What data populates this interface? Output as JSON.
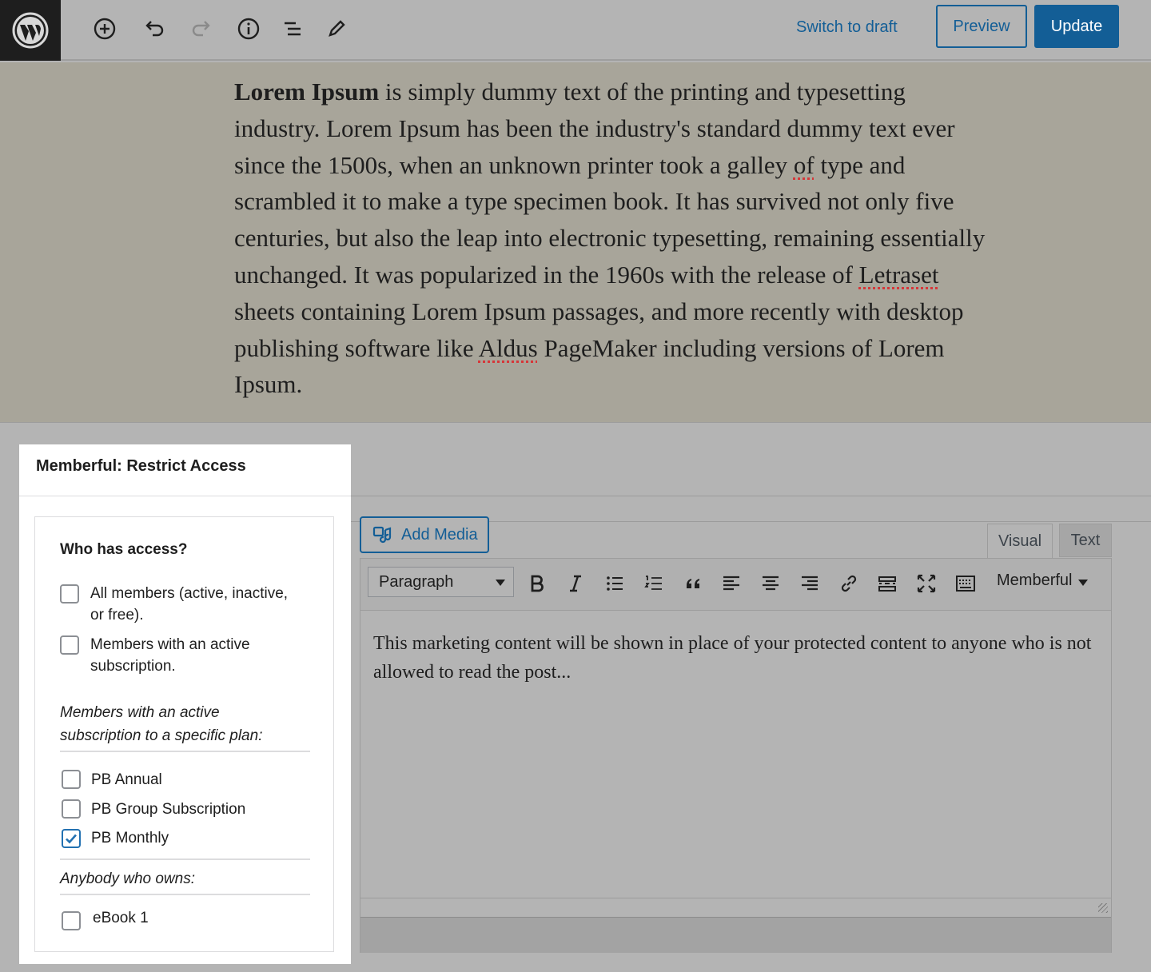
{
  "toolbar": {
    "switch_to_draft": "Switch to draft",
    "preview": "Preview",
    "update": "Update",
    "icons": [
      "wordpress-logo",
      "add-block-icon",
      "undo-icon",
      "redo-icon",
      "info-icon",
      "list-view-icon",
      "edit-icon"
    ]
  },
  "content": {
    "bold_lead": "Lorem Ipsum",
    "seg1": " is simply dummy text of the printing and typesetting industry. Lorem Ipsum has been the industry's standard dummy text ever since the 1500s, when an unknown printer took a galley ",
    "word_of": "of",
    "seg2": " type and scrambled it to make a type specimen book. It has survived not only five centuries, but also the leap into electronic typesetting, remaining essentially unchanged. It was popularized in the 1960s with the release of ",
    "word_letraset": "Letraset",
    "seg3": " sheets containing Lorem Ipsum passages, and more recently with desktop publishing software like ",
    "word_aldus": "Aldus",
    "seg4": " PageMaker including versions of Lorem Ipsum."
  },
  "metabox": {
    "title": "Memberful: Restrict Access",
    "heading": "Who has access?",
    "option_all_line1": "All members (active, inactive,",
    "option_all_line2": "or free).",
    "option_active_line1": "Members with an active",
    "option_active_line2": "subscription.",
    "plan_heading_line1": "Members with an active",
    "plan_heading_line2": "subscription to a specific plan:",
    "plans": [
      {
        "label": "PB Annual",
        "checked": false
      },
      {
        "label": "PB Group Subscription",
        "checked": false
      },
      {
        "label": "PB Monthly",
        "checked": true
      }
    ],
    "owns_heading": "Anybody who owns:",
    "products": [
      {
        "label": "eBook 1",
        "checked": false
      }
    ]
  },
  "editor": {
    "add_media": "Add Media",
    "tab_visual": "Visual",
    "tab_text": "Text",
    "format_select": "Paragraph",
    "memberful_dropdown": "Memberful",
    "body_text": "This marketing content will be shown in place of your protected content to anyone who is not allowed to read the post..."
  },
  "colors": {
    "accent": "#135e96",
    "checkbox_checked": "#2271b1"
  }
}
